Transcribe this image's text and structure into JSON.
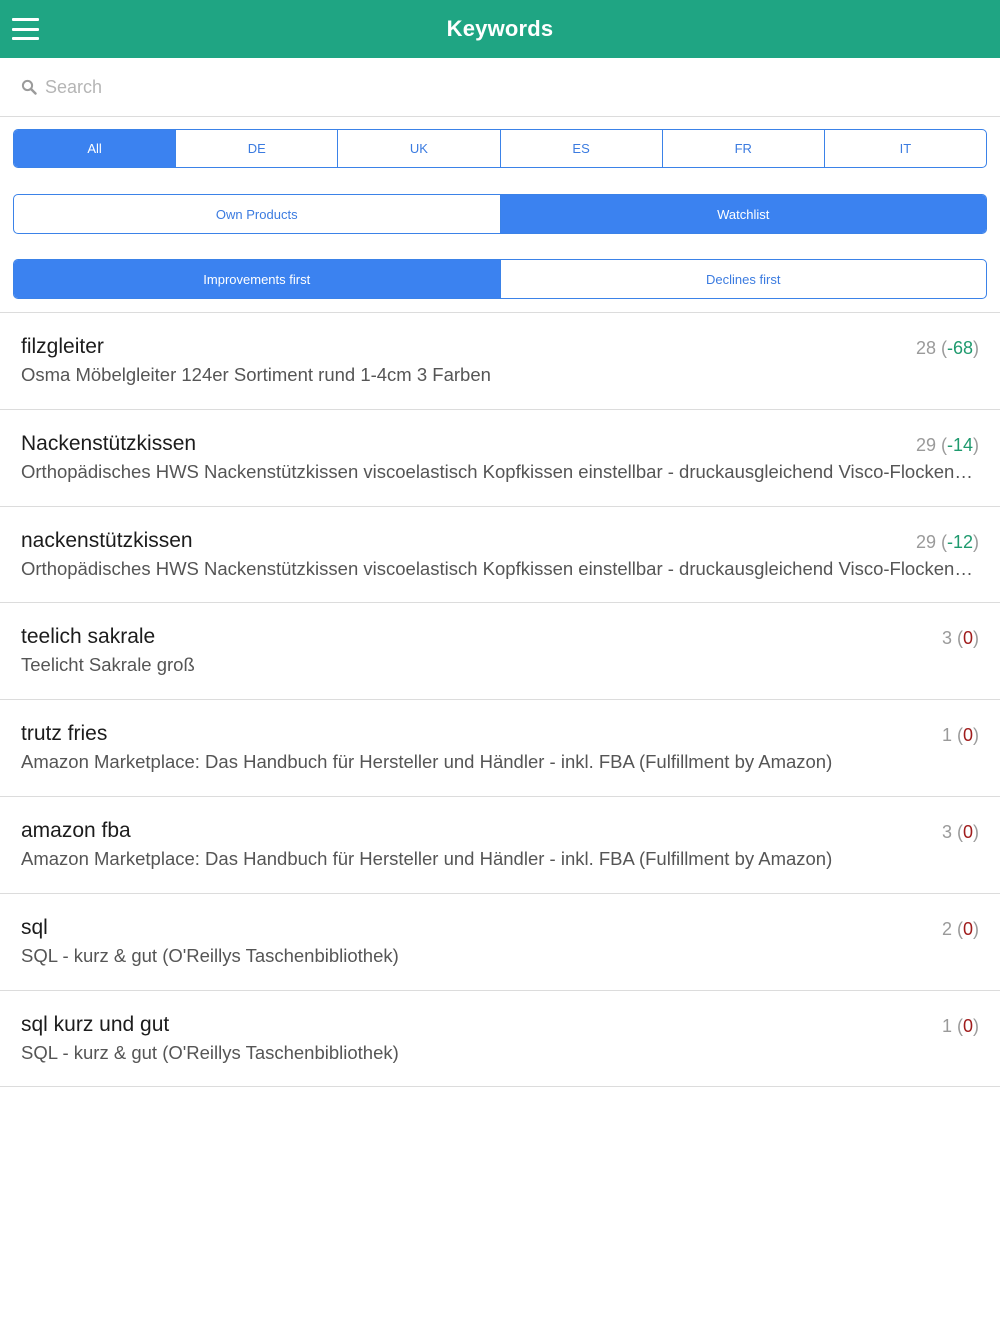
{
  "header": {
    "title": "Keywords"
  },
  "search": {
    "placeholder": "Search"
  },
  "country_tabs": [
    {
      "label": "All",
      "active": true
    },
    {
      "label": "DE",
      "active": false
    },
    {
      "label": "UK",
      "active": false
    },
    {
      "label": "ES",
      "active": false
    },
    {
      "label": "FR",
      "active": false
    },
    {
      "label": "IT",
      "active": false
    }
  ],
  "source_tabs": [
    {
      "label": "Own Products",
      "active": false
    },
    {
      "label": "Watchlist",
      "active": true
    }
  ],
  "sort_tabs": [
    {
      "label": "Improvements first",
      "active": true
    },
    {
      "label": "Declines first",
      "active": false
    }
  ],
  "keywords": [
    {
      "keyword": "filzgleiter",
      "product": "Osma Möbelgleiter 124er Sortiment rund 1-4cm 3 Farben",
      "rank": "28",
      "delta": "-68"
    },
    {
      "keyword": "Nackenstützkissen",
      "product": "Orthopädisches HWS Nackenstützkissen viscoelastisch Kopfkissen einstellbar - druckausgleichend Visco-Flocken Füllung",
      "rank": "29",
      "delta": "-14"
    },
    {
      "keyword": "nackenstützkissen",
      "product": "Orthopädisches HWS Nackenstützkissen viscoelastisch Kopfkissen einstellbar - druckausgleichend Visco-Flocken Füllung",
      "rank": "29",
      "delta": "-12"
    },
    {
      "keyword": "teelich sakrale",
      "product": "Teelicht Sakrale groß",
      "rank": "3",
      "delta": "0"
    },
    {
      "keyword": "trutz fries",
      "product": "Amazon Marketplace: Das Handbuch für Hersteller und Händler - inkl. FBA (Fulfillment by Amazon)",
      "rank": "1",
      "delta": "0"
    },
    {
      "keyword": "amazon fba",
      "product": "Amazon Marketplace: Das Handbuch für Hersteller und Händler - inkl. FBA (Fulfillment by Amazon)",
      "rank": "3",
      "delta": "0"
    },
    {
      "keyword": "sql",
      "product": "SQL - kurz & gut (O'Reillys Taschenbibliothek)",
      "rank": "2",
      "delta": "0"
    },
    {
      "keyword": "sql kurz und gut",
      "product": "SQL - kurz & gut (O'Reillys Taschenbibliothek)",
      "rank": "1",
      "delta": "0"
    }
  ],
  "colors": {
    "header_bg": "#1fa583",
    "accent_blue": "#3b82f0",
    "improvement_green": "#1f9a6e",
    "unchanged_red": "#a01c1c"
  }
}
